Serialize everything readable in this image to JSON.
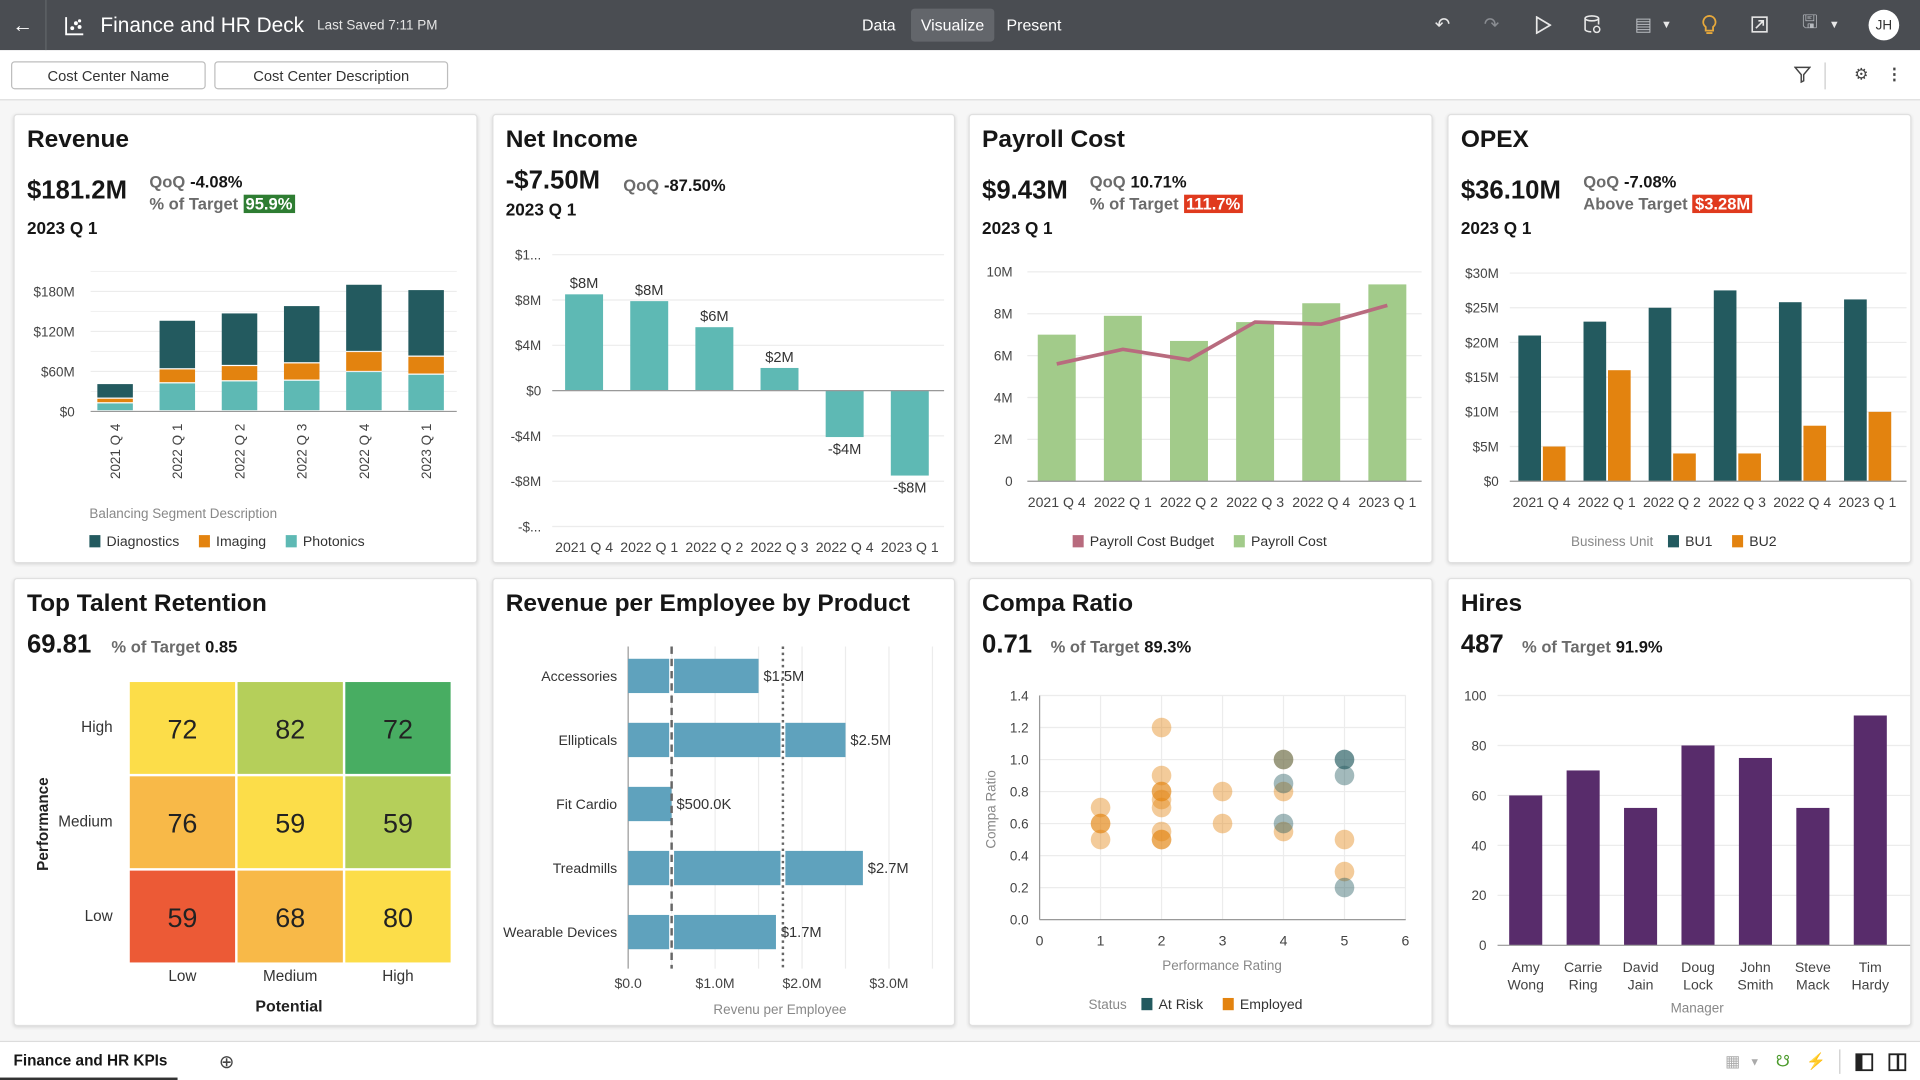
{
  "header": {
    "title": "Finance and HR Deck",
    "last_saved": "Last Saved 7:11 PM",
    "tabs": [
      "Data",
      "Visualize",
      "Present"
    ],
    "active_tab": "Visualize",
    "avatar": "JH",
    "bulb_color": "#e8a93b"
  },
  "filters": {
    "items": [
      "Cost Center Name",
      "Cost Center Description"
    ]
  },
  "cards": {
    "revenue": {
      "title": "Revenue",
      "value": "$181.2M",
      "qoq_label": "QoQ",
      "qoq": "-4.08%",
      "target_label": "% of Target",
      "target": "95.9%",
      "target_color": "#2e7d32",
      "period": "2023 Q 1"
    },
    "net_income": {
      "title": "Net Income",
      "value": "-$7.50M",
      "qoq_label": "QoQ",
      "qoq": "-87.50%",
      "period": "2023 Q 1"
    },
    "payroll": {
      "title": "Payroll Cost",
      "value": "$9.43M",
      "qoq_label": "QoQ",
      "qoq": "10.71%",
      "target_label": "% of Target",
      "target": "111.7%",
      "target_color": "#e03a1e",
      "period": "2023 Q 1"
    },
    "opex": {
      "title": "OPEX",
      "value": "$36.10M",
      "qoq_label": "QoQ",
      "qoq": "-7.08%",
      "target_label": "Above Target",
      "target": "$3.28M",
      "target_color": "#e03a1e",
      "period": "2023 Q 1"
    },
    "talent": {
      "title": "Top Talent Retention",
      "value": "69.81",
      "target_label": "% of Target",
      "target": "0.85"
    },
    "rev_emp": {
      "title": "Revenue per Employee by Product"
    },
    "compa": {
      "title": "Compa Ratio",
      "value": "0.71",
      "target_label": "% of Target",
      "target": "89.3%"
    },
    "hires": {
      "title": "Hires",
      "value": "487",
      "target_label": "% of Target",
      "target": "91.9%"
    }
  },
  "chart_data": [
    {
      "id": "revenue",
      "type": "bar",
      "stacked": true,
      "categories": [
        "2021 Q 4",
        "2022 Q 1",
        "2022 Q 2",
        "2022 Q 3",
        "2022 Q 4",
        "2023 Q 1"
      ],
      "series": [
        {
          "name": "Photonics",
          "color": "#5eb9b4",
          "values": [
            12,
            42,
            45,
            46,
            59,
            55
          ]
        },
        {
          "name": "Imaging",
          "color": "#e3830f",
          "values": [
            7,
            21,
            23,
            26,
            30,
            27
          ]
        },
        {
          "name": "Diagnostics",
          "color": "#235a5f",
          "values": [
            22,
            73,
            79,
            86,
            101,
            100
          ]
        }
      ],
      "legend_order": [
        "Diagnostics",
        "Imaging",
        "Photonics"
      ],
      "legend_title": "Balancing Segment Description",
      "ylim": [
        0,
        210
      ],
      "yticks": [
        0,
        60,
        120,
        180
      ],
      "ytick_labels": [
        "$0",
        "$60M",
        "$120M",
        "$180M"
      ],
      "units": "$M",
      "grid": true
    },
    {
      "id": "net_income",
      "type": "bar",
      "categories": [
        "2021 Q 4",
        "2022 Q 1",
        "2022 Q 2",
        "2022 Q 3",
        "2022 Q 4",
        "2023 Q 1"
      ],
      "values": [
        8.5,
        7.9,
        5.6,
        2.0,
        -4.1,
        -7.5
      ],
      "data_labels": [
        "$8M",
        "$8M",
        "$6M",
        "$2M",
        "-$4M",
        "-$8M"
      ],
      "color": "#5eb9b4",
      "ylim": [
        -12,
        12
      ],
      "yticks": [
        12,
        8,
        4,
        0,
        -4,
        -8,
        -12
      ],
      "ytick_labels": [
        "$1...",
        "$8M",
        "$4M",
        "$0",
        "-$4M",
        "-$8M",
        "-$..."
      ],
      "units": "$M",
      "grid": true
    },
    {
      "id": "payroll",
      "type": "bar+line",
      "categories": [
        "2021 Q 4",
        "2022 Q 1",
        "2022 Q 2",
        "2022 Q 3",
        "2022 Q 4",
        "2023 Q 1"
      ],
      "series": [
        {
          "name": "Payroll Cost",
          "type": "bar",
          "color": "#a2cb8a",
          "values": [
            7.0,
            7.9,
            6.7,
            7.6,
            8.5,
            9.4
          ]
        },
        {
          "name": "Payroll Cost Budget",
          "type": "line",
          "color": "#b86b7e",
          "values": [
            5.6,
            6.3,
            5.8,
            7.6,
            7.5,
            8.4
          ]
        }
      ],
      "legend_order": [
        "Payroll Cost Budget",
        "Payroll Cost"
      ],
      "ylim": [
        0,
        10
      ],
      "yticks": [
        0,
        2,
        4,
        6,
        8,
        10
      ],
      "ytick_labels": [
        "0",
        "2M",
        "4M",
        "6M",
        "8M",
        "10M"
      ],
      "units": "M",
      "grid": true
    },
    {
      "id": "opex",
      "type": "bar",
      "grouped": true,
      "categories": [
        "2021 Q 4",
        "2022 Q 1",
        "2022 Q 2",
        "2022 Q 3",
        "2022 Q 4",
        "2023 Q 1"
      ],
      "series": [
        {
          "name": "BU1",
          "color": "#235a5f",
          "values": [
            21,
            23,
            25,
            27.5,
            25.8,
            26.2
          ]
        },
        {
          "name": "BU2",
          "color": "#e3830f",
          "values": [
            5,
            16,
            4,
            4,
            8,
            10
          ]
        }
      ],
      "legend_title": "Business Unit",
      "ylim": [
        0,
        30
      ],
      "yticks": [
        0,
        5,
        10,
        15,
        20,
        25,
        30
      ],
      "ytick_labels": [
        "$0",
        "$5M",
        "$10M",
        "$15M",
        "$20M",
        "$25M",
        "$30M"
      ],
      "units": "$M",
      "grid": true
    },
    {
      "id": "talent",
      "type": "heatmap",
      "xlabel": "Potential",
      "ylabel": "Performance",
      "x_categories": [
        "Low",
        "Medium",
        "High"
      ],
      "y_categories": [
        "High",
        "Medium",
        "Low"
      ],
      "values": [
        [
          72,
          82,
          72
        ],
        [
          76,
          59,
          59
        ],
        [
          59,
          68,
          80
        ]
      ],
      "cell_colors": [
        [
          "#fcdd49",
          "#b5cf5a",
          "#48ad62"
        ],
        [
          "#f8b948",
          "#fcdd49",
          "#b5cf5a"
        ],
        [
          "#ec5a36",
          "#f8b948",
          "#fcdd49"
        ]
      ]
    },
    {
      "id": "rev_emp",
      "type": "bar",
      "orientation": "horizontal",
      "categories": [
        "Accessories",
        "Ellipticals",
        "Fit Cardio",
        "Treadmills",
        "Wearable Devices"
      ],
      "values": [
        1.5,
        2.5,
        0.5,
        2.7,
        1.7
      ],
      "data_labels": [
        "$1.5M",
        "$2.5M",
        "$500.0K",
        "$2.7M",
        "$1.7M"
      ],
      "color": "#5fa2bd",
      "xlabel": "Revenu per Employee",
      "xlim": [
        0,
        3.5
      ],
      "xticks": [
        0,
        1,
        2,
        3
      ],
      "xtick_labels": [
        "$0.0",
        "$1.0M",
        "$2.0M",
        "$3.0M"
      ],
      "units": "$M",
      "reference_lines": [
        {
          "value": 0.5,
          "style": "dashed"
        },
        {
          "value": 1.78,
          "style": "dotted"
        }
      ],
      "grid": true
    },
    {
      "id": "compa",
      "type": "scatter",
      "xlabel": "Performance Rating",
      "ylabel": "Compa Ratio",
      "legend_title": "Status",
      "xlim": [
        0,
        6
      ],
      "ylim": [
        0,
        1.4
      ],
      "xticks": [
        0,
        1,
        2,
        3,
        4,
        5,
        6
      ],
      "yticks": [
        0,
        0.2,
        0.4,
        0.6,
        0.8,
        1.0,
        1.2,
        1.4
      ],
      "ytick_labels": [
        "0.0",
        "0.2",
        "0.4",
        "0.6",
        "0.8",
        "1.0",
        "1.2",
        "1.4"
      ],
      "series": [
        {
          "name": "At Risk",
          "color": "#235a5f",
          "points": [
            [
              4,
              1.0
            ],
            [
              4,
              0.85
            ],
            [
              4,
              0.6
            ],
            [
              5,
              1.0
            ],
            [
              5,
              1.0
            ],
            [
              5,
              0.9
            ],
            [
              5,
              0.2
            ]
          ]
        },
        {
          "name": "Employed",
          "color": "#e3830f",
          "points": [
            [
              1,
              0.7
            ],
            [
              1,
              0.6
            ],
            [
              1,
              0.6
            ],
            [
              1,
              0.5
            ],
            [
              2,
              1.2
            ],
            [
              2,
              0.9
            ],
            [
              2,
              0.8
            ],
            [
              2,
              0.8
            ],
            [
              2,
              0.75
            ],
            [
              2,
              0.7
            ],
            [
              2,
              0.55
            ],
            [
              2,
              0.5
            ],
            [
              2,
              0.5
            ],
            [
              3,
              0.8
            ],
            [
              3,
              0.6
            ],
            [
              4,
              1.0
            ],
            [
              4,
              0.8
            ],
            [
              4,
              0.55
            ],
            [
              5,
              0.5
            ],
            [
              5,
              0.3
            ]
          ]
        }
      ],
      "grid": true
    },
    {
      "id": "hires",
      "type": "bar",
      "categories": [
        "Amy Wong",
        "Carrie Ring",
        "David Jain",
        "Doug Lock",
        "John Smith",
        "Steve Mack",
        "Tim Hardy"
      ],
      "values": [
        60,
        70,
        55,
        80,
        75,
        55,
        92
      ],
      "color": "#582c6b",
      "xlabel": "Manager",
      "ylim": [
        0,
        100
      ],
      "yticks": [
        0,
        20,
        40,
        60,
        80,
        100
      ],
      "ytick_labels": [
        "0",
        "20",
        "40",
        "60",
        "80",
        "100"
      ],
      "grid": true
    }
  ],
  "footer": {
    "sheet_tab": "Finance and HR KPIs"
  }
}
